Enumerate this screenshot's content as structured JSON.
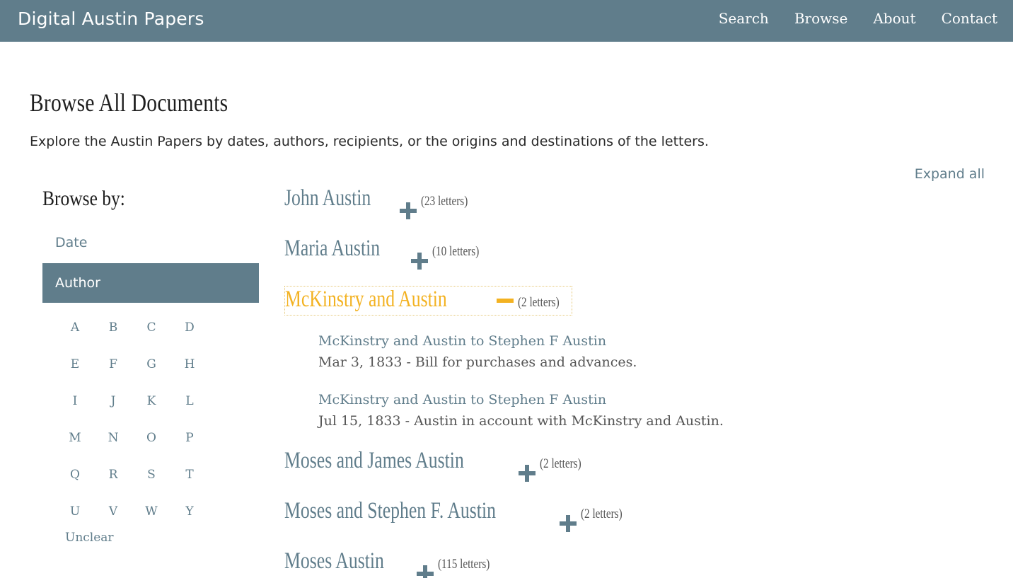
{
  "header": {
    "brand": "Digital Austin Papers",
    "nav": [
      "Search",
      "Browse",
      "About",
      "Contact"
    ]
  },
  "page": {
    "title": "Browse All Documents",
    "intro": "Explore the Austin Papers by dates, authors, recipients, or the origins and destinations of the letters.",
    "expand_all": "Expand all"
  },
  "sidebar": {
    "heading": "Browse by:",
    "options": [
      {
        "label": "Date",
        "active": false
      },
      {
        "label": "Author",
        "active": true
      }
    ],
    "letters": [
      "A",
      "B",
      "C",
      "D",
      "E",
      "F",
      "G",
      "H",
      "I",
      "J",
      "K",
      "L",
      "M",
      "N",
      "O",
      "P",
      "Q",
      "R",
      "S",
      "T",
      "U",
      "V",
      "W",
      "Y"
    ],
    "unclear": "Unclear"
  },
  "authors": [
    {
      "name": "John Austin",
      "count": "(23 letters)",
      "expanded": false
    },
    {
      "name": "Maria Austin",
      "count": "(10 letters)",
      "expanded": false
    },
    {
      "name": "McKinstry and Austin",
      "count": "(2 letters)",
      "expanded": true,
      "documents": [
        {
          "title": "McKinstry and Austin to Stephen F Austin",
          "desc": "Mar 3, 1833 - Bill for purchases and advances."
        },
        {
          "title": "McKinstry and Austin to Stephen F Austin",
          "desc": "Jul 15, 1833 - Austin in account with McKinstry and Austin."
        }
      ]
    },
    {
      "name": "Moses and James Austin",
      "count": "(2 letters)",
      "expanded": false
    },
    {
      "name": "Moses and Stephen F. Austin",
      "count": "(2 letters)",
      "expanded": false
    },
    {
      "name": "Moses Austin",
      "count": "(115 letters)",
      "expanded": false
    }
  ],
  "colors": {
    "navbar": "#607d8b",
    "link": "#607d8b",
    "accent": "#f3b221"
  },
  "icons": {
    "collapsed": "plus-icon",
    "expanded": "minus-icon"
  }
}
